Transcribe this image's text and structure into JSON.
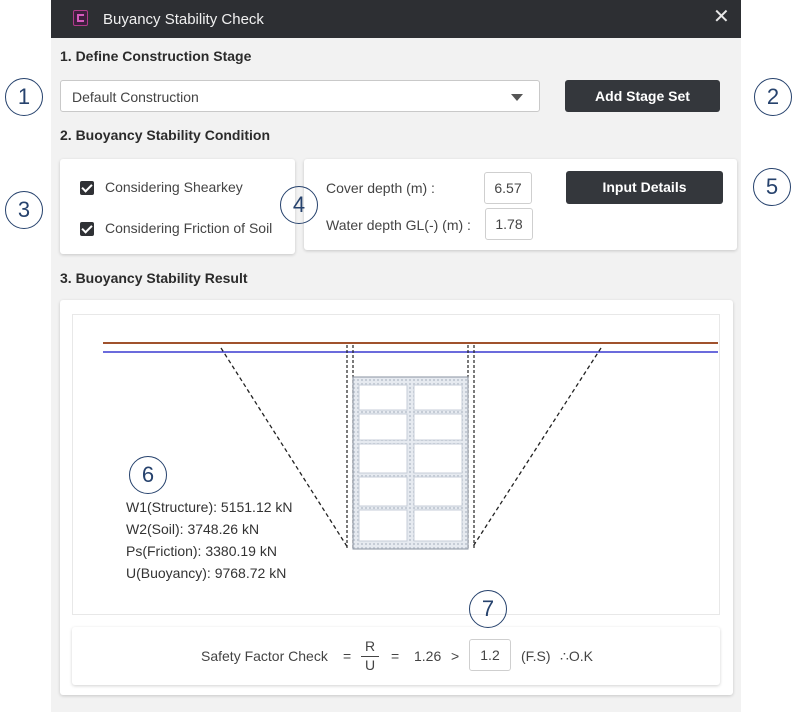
{
  "window": {
    "title": "Buyancy Stability Check",
    "close_icon": "close-icon",
    "app_icon": "app-logo-icon"
  },
  "stage": {
    "heading": "1. Define Construction Stage",
    "select_value": "Default Construction",
    "add_button": "Add Stage Set"
  },
  "condition": {
    "heading": "2. Buoyancy Stability Condition",
    "shearkey": {
      "label": "Considering Shearkey",
      "checked": true
    },
    "friction": {
      "label": "Considering Friction of Soil",
      "checked": true
    },
    "cover_depth": {
      "label": "Cover depth (m) :",
      "value": "6.57"
    },
    "water_depth": {
      "label": "Water depth GL(-) (m) :",
      "value": "1.78"
    },
    "details_button": "Input Details"
  },
  "result": {
    "heading": "3. Buoyancy Stability Result",
    "w1": "W1(Structure): 5151.12 kN",
    "w2": "W2(Soil): 3748.26 kN",
    "ps": "Ps(Friction): 3380.19 kN",
    "u": "U(Buoyancy): 9768.72 kN"
  },
  "safety": {
    "label": "Safety Factor Check",
    "eq1": "=",
    "numerator": "R",
    "denominator": "U",
    "eq2": "=",
    "value": "1.26",
    "gt": ">",
    "limit": "1.2",
    "unit": "(F.S)",
    "verdict": "∴O.K"
  },
  "callouts": [
    "1",
    "2",
    "3",
    "4",
    "5",
    "6",
    "7"
  ],
  "colors": {
    "ground_line": "#a0522d",
    "water_line": "#3a3ad0",
    "titlebar": "#2d2f33",
    "button": "#34373c"
  }
}
